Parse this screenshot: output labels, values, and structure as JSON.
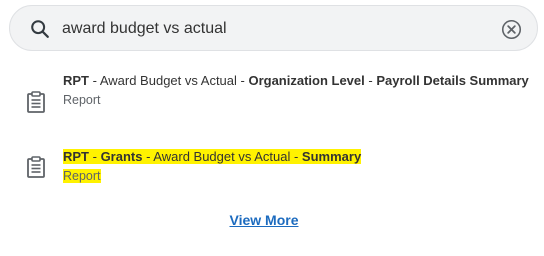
{
  "search": {
    "value": "award budget vs actual",
    "search_icon": "search-icon",
    "clear_icon": "clear-circle-x-icon"
  },
  "results": [
    {
      "icon": "report-document-icon",
      "title_parts": [
        {
          "text": "RPT",
          "bold": true
        },
        {
          "text": " - Award Budget vs Actual - ",
          "bold": false
        },
        {
          "text": "Organization Level",
          "bold": true
        },
        {
          "text": " - ",
          "bold": false
        },
        {
          "text": "Payroll Details Summary",
          "bold": true
        }
      ],
      "type": "Report",
      "highlighted": false
    },
    {
      "icon": "report-document-icon",
      "title_parts": [
        {
          "text": "RPT",
          "bold": true
        },
        {
          "text": " - ",
          "bold": false
        },
        {
          "text": "Grants",
          "bold": true
        },
        {
          "text": " - Award Budget vs Actual - ",
          "bold": false
        },
        {
          "text": "Summary",
          "bold": true
        }
      ],
      "type": "Report",
      "highlighted": true
    }
  ],
  "view_more_label": "View More",
  "colors": {
    "link": "#1c6bbf",
    "highlight": "#fff200",
    "search_bg": "#f2f3f4"
  }
}
